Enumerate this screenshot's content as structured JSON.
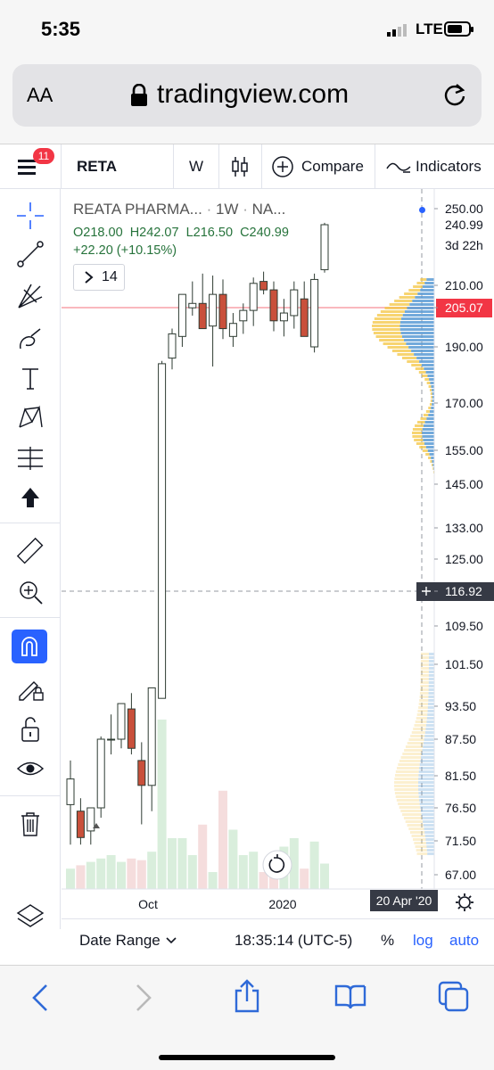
{
  "status_bar": {
    "time": "5:35",
    "network": "LTE"
  },
  "browser": {
    "aa_label": "AA",
    "host": "tradingview.com"
  },
  "toolbar": {
    "notification_count": "11",
    "symbol": "RETA",
    "interval": "W",
    "compare_label": "Compare",
    "indicators_label": "Indicators"
  },
  "legend": {
    "title": "REATA PHARMA...",
    "interval": "1W",
    "exchange": "NA...",
    "ohlc": {
      "o": "O218.00",
      "h": "H242.07",
      "l": "L216.50",
      "c": "C240.99"
    },
    "change": "+22.20 (+10.15%)",
    "collapsed_count": "14"
  },
  "price_axis": {
    "labels": [
      "250.00",
      "240.99",
      "3d 22h",
      "210.00",
      "205.07",
      "190.00",
      "170.00",
      "155.00",
      "145.00",
      "133.00",
      "125.00",
      "116.92",
      "109.50",
      "101.50",
      "93.50",
      "87.50",
      "81.50",
      "76.50",
      "71.50",
      "67.00"
    ],
    "last_price": "240.99",
    "countdown": "3d 22h",
    "highlight_price": "205.07",
    "crosshair_price": "116.92"
  },
  "time_axis": {
    "labels": [
      "Oct",
      "2020"
    ],
    "crosshair_date": "20 Apr '20"
  },
  "bottom_bar": {
    "date_range_label": "Date Range",
    "clock": "18:35:14 (UTC-5)",
    "percent_label": "%",
    "log_label": "log",
    "auto_label": "auto"
  },
  "colors": {
    "up": "#ffffff",
    "down": "#c9503b",
    "outline": "#2e3b32",
    "accent": "#2962ff",
    "highlight": "#f23645"
  },
  "chart_data": {
    "type": "candlestick",
    "series": [
      {
        "o": 77,
        "h": 84,
        "l": 71,
        "c": 81
      },
      {
        "o": 76,
        "h": 78,
        "l": 71,
        "c": 72
      },
      {
        "o": 73,
        "h": 76.5,
        "l": 71,
        "c": 76.5
      },
      {
        "o": 76.5,
        "h": 88,
        "l": 75,
        "c": 87.5
      },
      {
        "o": 87.5,
        "h": 92,
        "l": 85,
        "c": 87.5
      },
      {
        "o": 87.5,
        "h": 94,
        "l": 86,
        "c": 94
      },
      {
        "o": 93,
        "h": 96,
        "l": 85,
        "c": 86
      },
      {
        "o": 84,
        "h": 87,
        "l": 74,
        "c": 80
      },
      {
        "o": 80,
        "h": 97,
        "l": 76,
        "c": 97
      },
      {
        "o": 95,
        "h": 185,
        "l": 95,
        "c": 184
      },
      {
        "o": 186,
        "h": 197,
        "l": 182,
        "c": 195
      },
      {
        "o": 194,
        "h": 205,
        "l": 190,
        "c": 208
      },
      {
        "o": 205,
        "h": 212,
        "l": 202,
        "c": 206
      },
      {
        "o": 206,
        "h": 216,
        "l": 200,
        "c": 197
      },
      {
        "o": 198,
        "h": 215,
        "l": 183,
        "c": 208
      },
      {
        "o": 208,
        "h": 213,
        "l": 193,
        "c": 197
      },
      {
        "o": 194,
        "h": 203,
        "l": 190,
        "c": 199
      },
      {
        "o": 200,
        "h": 206,
        "l": 195,
        "c": 204
      },
      {
        "o": 204,
        "h": 214,
        "l": 198,
        "c": 211
      },
      {
        "o": 212,
        "h": 217,
        "l": 208,
        "c": 209
      },
      {
        "o": 209,
        "h": 212,
        "l": 196,
        "c": 200
      },
      {
        "o": 200,
        "h": 207,
        "l": 194,
        "c": 203
      },
      {
        "o": 202,
        "h": 212,
        "l": 197,
        "c": 209
      },
      {
        "o": 207,
        "h": 212,
        "l": 195,
        "c": 194
      },
      {
        "o": 190,
        "h": 216,
        "l": 188,
        "c": 213
      },
      {
        "o": 218,
        "h": 242.07,
        "l": 216.5,
        "c": 240.99
      }
    ],
    "volume_relative": [
      0.12,
      0.14,
      0.16,
      0.18,
      0.2,
      0.16,
      0.18,
      0.17,
      0.22,
      1.0,
      0.3,
      0.3,
      0.2,
      0.38,
      0.1,
      0.58,
      0.35,
      0.2,
      0.22,
      0.1,
      0.2,
      0.25,
      0.3,
      0.12,
      0.28,
      0.15
    ]
  }
}
